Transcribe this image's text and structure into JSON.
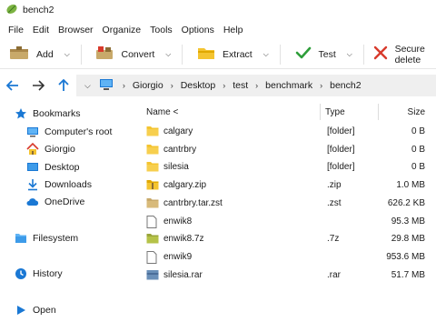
{
  "window": {
    "title": "bench2"
  },
  "menu": [
    "File",
    "Edit",
    "Browser",
    "Organize",
    "Tools",
    "Options",
    "Help"
  ],
  "toolbar": {
    "add": "Add",
    "convert": "Convert",
    "extract": "Extract",
    "test": "Test",
    "secure_delete": "Secure delete"
  },
  "breadcrumb": [
    "Giorgio",
    "Desktop",
    "test",
    "benchmark",
    "bench2"
  ],
  "sidebar": {
    "bookmarks": "Bookmarks",
    "items": [
      "Computer's root",
      "Giorgio",
      "Desktop",
      "Downloads",
      "OneDrive"
    ],
    "filesystem": "Filesystem",
    "history": "History",
    "open": "Open"
  },
  "columns": {
    "name": "Name <",
    "type": "Type",
    "size": "Size"
  },
  "files": [
    {
      "name": "calgary",
      "type": "[folder]",
      "size": "0 B",
      "icon": "folder-icon"
    },
    {
      "name": "cantrbry",
      "type": "[folder]",
      "size": "0 B",
      "icon": "folder-icon"
    },
    {
      "name": "silesia",
      "type": "[folder]",
      "size": "0 B",
      "icon": "folder-icon"
    },
    {
      "name": "calgary.zip",
      "type": ".zip",
      "size": "1.0 MB",
      "icon": "zip-archive-icon"
    },
    {
      "name": "cantrbry.tar.zst",
      "type": ".zst",
      "size": "626.2 KB",
      "icon": "zst-archive-icon"
    },
    {
      "name": "enwik8",
      "type": "",
      "size": "95.3 MB",
      "icon": "file-icon"
    },
    {
      "name": "enwik8.7z",
      "type": ".7z",
      "size": "29.8 MB",
      "icon": "7z-archive-icon"
    },
    {
      "name": "enwik9",
      "type": "",
      "size": "953.6 MB",
      "icon": "file-icon"
    },
    {
      "name": "silesia.rar",
      "type": ".rar",
      "size": "51.7 MB",
      "icon": "rar-archive-icon"
    }
  ],
  "colors": {
    "folder": "#f4c430",
    "accent": "#1a78d4",
    "test_green": "#2e9e3a",
    "delete_red": "#d83a2c"
  }
}
